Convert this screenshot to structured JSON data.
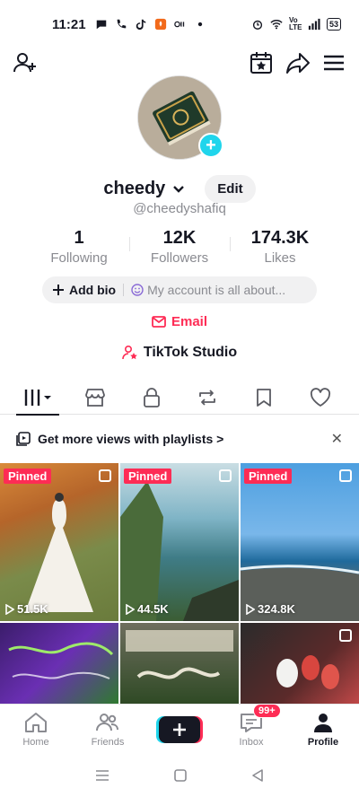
{
  "status_bar": {
    "time": "11:21",
    "battery": "53",
    "network": "Vo LTE"
  },
  "profile": {
    "username": "cheedy",
    "handle": "@cheedyshafiq",
    "edit_label": "Edit",
    "stats": [
      {
        "value": "1",
        "label": "Following"
      },
      {
        "value": "12K",
        "label": "Followers"
      },
      {
        "value": "174.3K",
        "label": "Likes"
      }
    ],
    "add_bio_label": "Add bio",
    "bio_placeholder": "My account is all about...",
    "email_label": "Email",
    "studio_label": "TikTok Studio"
  },
  "tabs": [
    {
      "icon": "grid-videos-icon",
      "active": true
    },
    {
      "icon": "shop-icon"
    },
    {
      "icon": "lock-icon"
    },
    {
      "icon": "repost-icon"
    },
    {
      "icon": "bookmark-icon"
    },
    {
      "icon": "heart-icon"
    }
  ],
  "playlist_banner": {
    "text": "Get more views with playlists >"
  },
  "videos": [
    {
      "pinned": "Pinned",
      "views": "51.5K"
    },
    {
      "pinned": "Pinned",
      "views": "44.5K"
    },
    {
      "pinned": "Pinned",
      "views": "324.8K"
    },
    {
      "pinned": "",
      "views": ""
    },
    {
      "pinned": "",
      "views": ""
    },
    {
      "pinned": "",
      "views": ""
    }
  ],
  "bottom_nav": {
    "home": "Home",
    "friends": "Friends",
    "inbox": "Inbox",
    "inbox_badge": "99+",
    "profile": "Profile"
  },
  "colors": {
    "accent": "#fe2c55",
    "cyan": "#20d5ec",
    "text": "#161823",
    "muted": "#8a8b91"
  }
}
